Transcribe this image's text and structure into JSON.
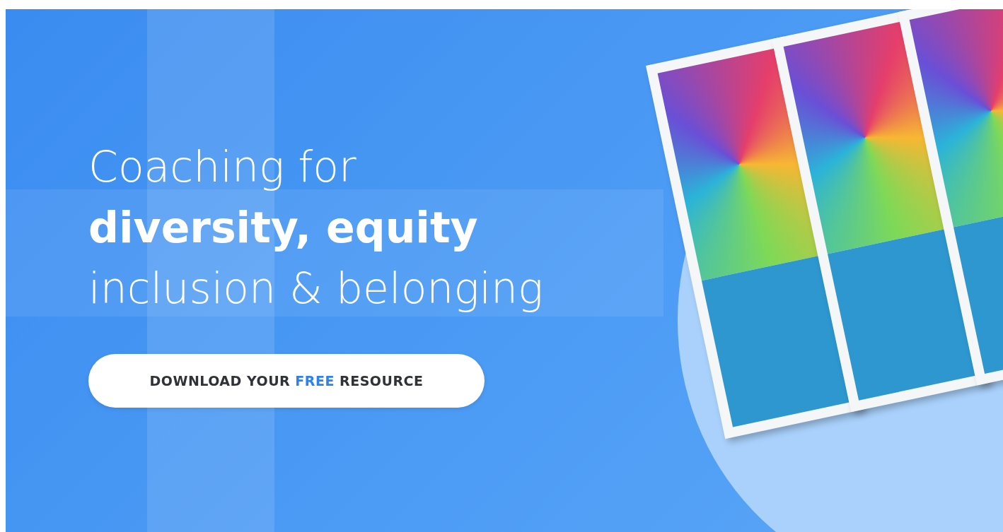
{
  "banner": {
    "heading_lines": [
      "Coaching for",
      "**diversity, equity**",
      "inclusion & belonging"
    ],
    "cta_button": {
      "label": "DOWNLOAD YOUR **FREE** RESOURCE"
    }
  }
}
